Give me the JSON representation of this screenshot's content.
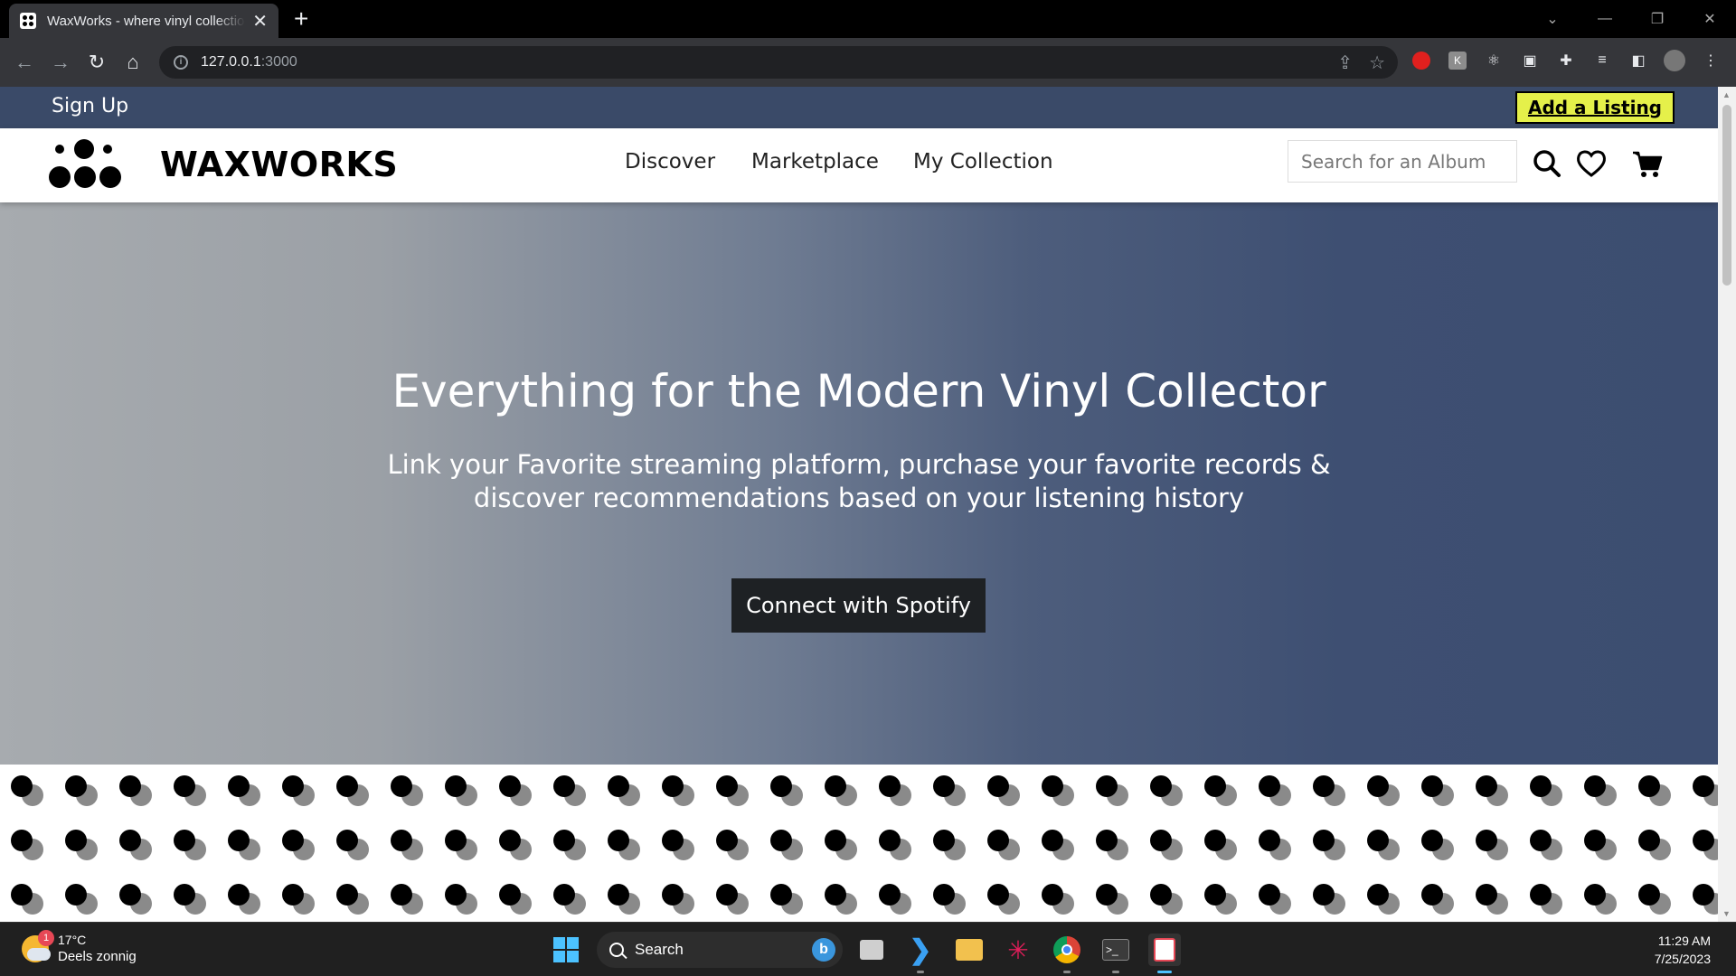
{
  "browser": {
    "tab_title": "WaxWorks - where vinyl collectio",
    "url_host": "127.0.0.1",
    "url_port": ":3000"
  },
  "site": {
    "signup_label": "Sign Up",
    "add_listing_label": "Add a Listing",
    "brand_name": "WAXWORKS",
    "nav": [
      "Discover",
      "Marketplace",
      "My Collection"
    ],
    "search_placeholder": "Search for an Album"
  },
  "hero": {
    "headline": "Everything for the Modern Vinyl Collector",
    "subtext": "Link your Favorite streaming platform, purchase your favorite records & discover recommendations based on your listening history",
    "cta_label": "Connect with Spotify"
  },
  "taskbar": {
    "weather_temp": "17°C",
    "weather_condition": "Deels zonnig",
    "weather_badge": "1",
    "search_label": "Search",
    "time": "11:29 AM",
    "date": "7/25/2023"
  },
  "colors": {
    "top_strip": "#3a4a68",
    "add_listing_bg": "#e5f04a",
    "cta_bg": "#1e2124"
  }
}
